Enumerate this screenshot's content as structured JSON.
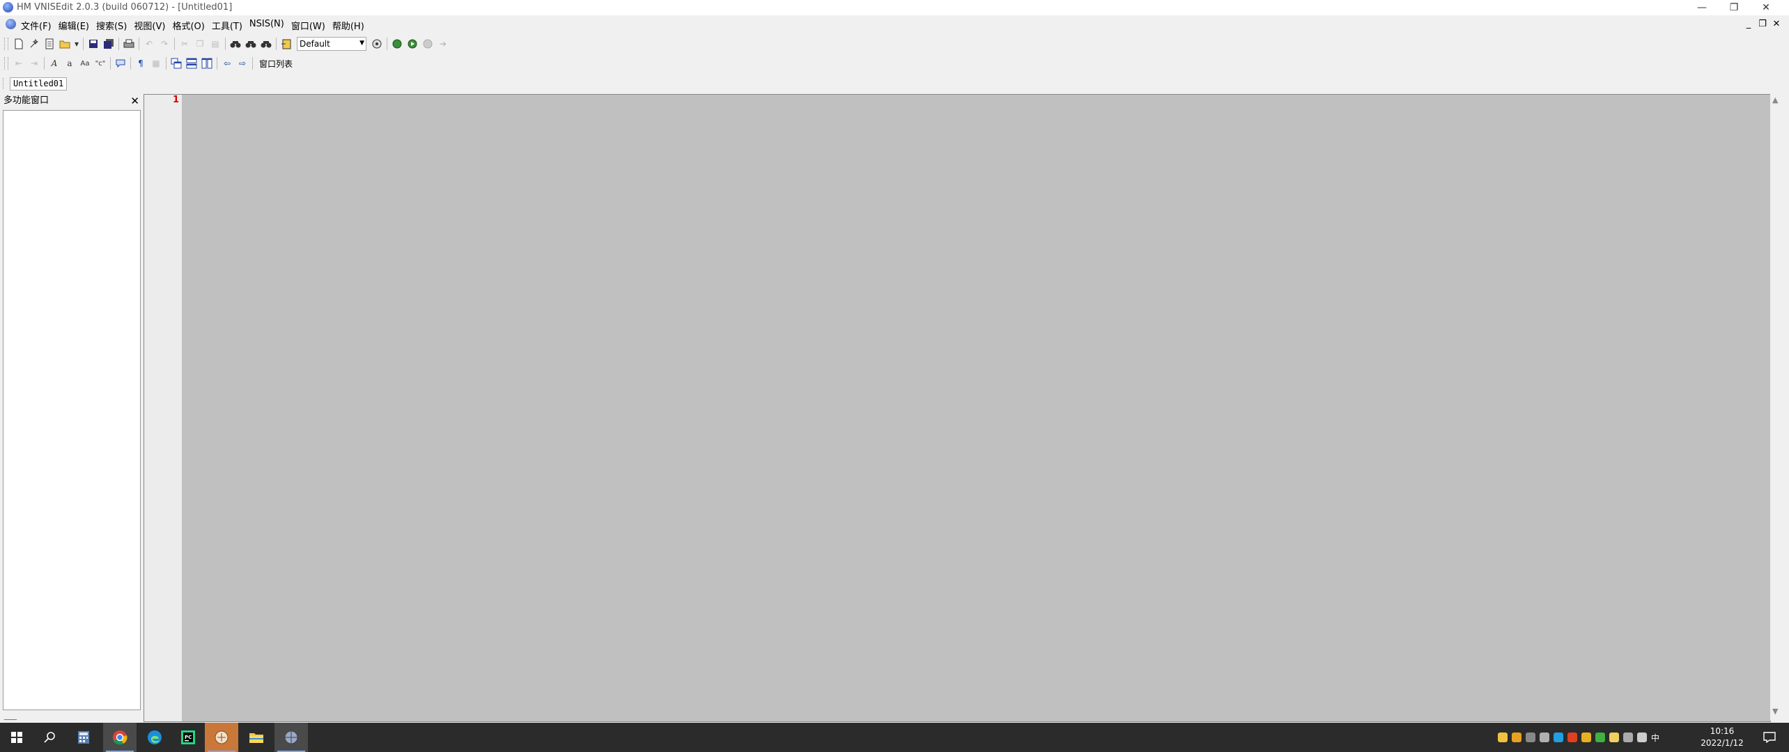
{
  "window": {
    "title": "HM VNISEdit 2.0.3 (build 060712) - [Untitled01]",
    "minimize": "—",
    "restore": "❐",
    "close": "✕"
  },
  "menu": {
    "items": [
      "文件(F)",
      "编辑(E)",
      "搜索(S)",
      "视图(V)",
      "格式(O)",
      "工具(T)",
      "NSIS(N)",
      "窗口(W)",
      "帮助(H)"
    ],
    "mdi_min": "_",
    "mdi_restore": "❐",
    "mdi_close": "✕"
  },
  "toolbar": {
    "scheme_combo": "Default",
    "window_list": "窗口列表"
  },
  "tabs": [
    "Untitled01"
  ],
  "side_panel": {
    "title": "多功能窗口",
    "close": "✕",
    "footer": "___"
  },
  "editor": {
    "line_numbers": [
      "1"
    ],
    "background": "#c0c0c0",
    "line_number_color": "#d00000"
  },
  "taskbar": {
    "time": "10:16",
    "date": "2022/1/12",
    "ime": "中"
  }
}
